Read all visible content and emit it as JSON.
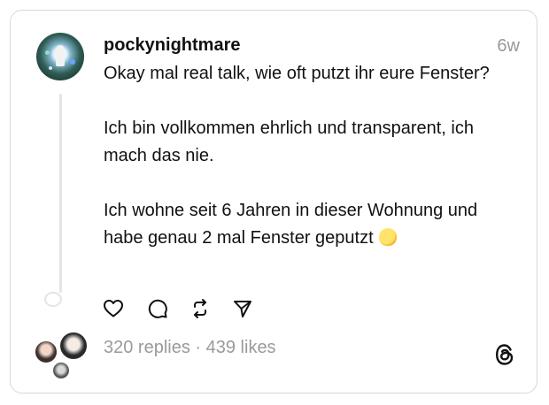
{
  "post": {
    "username": "pockynightmare",
    "time_ago": "6w",
    "paragraphs": [
      "Okay mal real talk, wie oft putzt ihr eure Fenster?",
      "Ich bin vollkommen ehrlich und transparent, ich mach das nie.",
      "Ich wohne seit 6 Jahren in dieser Wohnung und habe genau 2 mal Fenster geputzt"
    ],
    "emoji": "melting-face"
  },
  "actions": {
    "like_icon": "heart-icon",
    "reply_icon": "comment-icon",
    "repost_icon": "repost-icon",
    "share_icon": "send-icon"
  },
  "stats": {
    "replies": "320 replies",
    "separator": " · ",
    "likes": "439 likes"
  },
  "brand_icon": "threads-logo-icon"
}
